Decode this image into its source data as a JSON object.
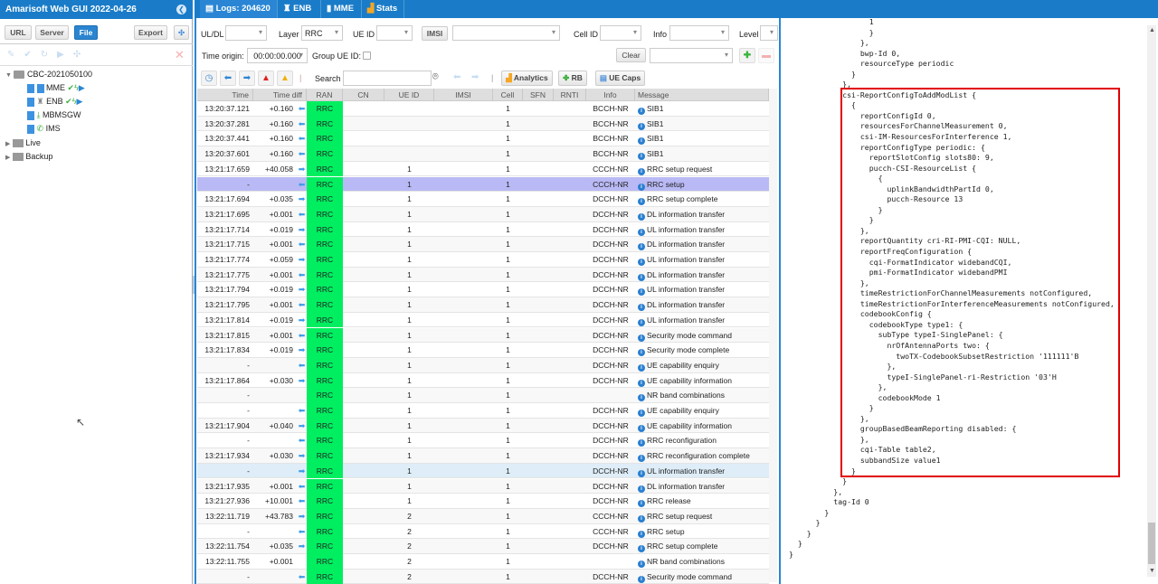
{
  "app": {
    "title": "Amarisoft Web GUI 2022-04-26"
  },
  "left": {
    "buttons": {
      "url": "URL",
      "server": "Server",
      "file": "File",
      "export": "Export"
    },
    "tree": {
      "root": "CBC-2021050100",
      "items": [
        "MME",
        "ENB",
        "MBMSGW",
        "IMS"
      ],
      "live": "Live",
      "backup": "Backup"
    }
  },
  "tabs": [
    {
      "label": "Logs: 204620",
      "icon": "document-icon"
    },
    {
      "label": "ENB",
      "icon": "antenna-icon"
    },
    {
      "label": "MME",
      "icon": "server-icon"
    },
    {
      "label": "Stats",
      "icon": "bar-chart-icon"
    }
  ],
  "filters": {
    "uldl_label": "UL/DL",
    "uldl_value": "",
    "layer_label": "Layer",
    "layer_value": "RRC",
    "ueid_label": "UE ID",
    "ueid_value": "",
    "imsi_label": "IMSI",
    "imsi_value": "",
    "cellid_label": "Cell ID",
    "cellid_value": "",
    "info_label": "Info",
    "info_value": "",
    "level_label": "Level",
    "level_value": "",
    "time_origin_label": "Time origin:",
    "time_origin_value": "00:00:00.000",
    "group_ueid_label": "Group UE ID:",
    "group_ueid_checked": false,
    "clear_label": "Clear"
  },
  "toolbar": {
    "search_label": "Search",
    "search_value": "",
    "analytics": "Analytics",
    "rb": "RB",
    "uecaps": "UE Caps"
  },
  "table": {
    "columns": [
      "Time",
      "Time diff",
      "RAN",
      "CN",
      "UE ID",
      "IMSI",
      "Cell",
      "SFN",
      "RNTI",
      "Info",
      "Message"
    ],
    "ran_color": "#00ee60",
    "rows": [
      {
        "time": "13:20:37.121",
        "diff": "+0.160",
        "dir": "dl",
        "ran": "RRC",
        "ue": "",
        "cell": "1",
        "info": "BCCH-NR",
        "msg": "SIB1"
      },
      {
        "time": "13:20:37.281",
        "diff": "+0.160",
        "dir": "dl",
        "ran": "RRC",
        "ue": "",
        "cell": "1",
        "info": "BCCH-NR",
        "msg": "SIB1"
      },
      {
        "time": "13:20:37.441",
        "diff": "+0.160",
        "dir": "dl",
        "ran": "RRC",
        "ue": "",
        "cell": "1",
        "info": "BCCH-NR",
        "msg": "SIB1"
      },
      {
        "time": "13:20:37.601",
        "diff": "+0.160",
        "dir": "dl",
        "ran": "RRC",
        "ue": "",
        "cell": "1",
        "info": "BCCH-NR",
        "msg": "SIB1"
      },
      {
        "time": "13:21:17.659",
        "diff": "+40.058",
        "dir": "ul",
        "ran": "RRC",
        "ue": "1",
        "cell": "1",
        "info": "CCCH-NR",
        "msg": "RRC setup request"
      },
      {
        "time": "-",
        "diff": "",
        "dir": "dl",
        "ran": "RRC",
        "ue": "1",
        "cell": "1",
        "info": "CCCH-NR",
        "msg": "RRC setup",
        "selected": true
      },
      {
        "time": "13:21:17.694",
        "diff": "+0.035",
        "dir": "ul",
        "ran": "RRC",
        "ue": "1",
        "cell": "1",
        "info": "DCCH-NR",
        "msg": "RRC setup complete"
      },
      {
        "time": "13:21:17.695",
        "diff": "+0.001",
        "dir": "dl",
        "ran": "RRC",
        "ue": "1",
        "cell": "1",
        "info": "DCCH-NR",
        "msg": "DL information transfer"
      },
      {
        "time": "13:21:17.714",
        "diff": "+0.019",
        "dir": "ul",
        "ran": "RRC",
        "ue": "1",
        "cell": "1",
        "info": "DCCH-NR",
        "msg": "UL information transfer"
      },
      {
        "time": "13:21:17.715",
        "diff": "+0.001",
        "dir": "dl",
        "ran": "RRC",
        "ue": "1",
        "cell": "1",
        "info": "DCCH-NR",
        "msg": "DL information transfer"
      },
      {
        "time": "13:21:17.774",
        "diff": "+0.059",
        "dir": "ul",
        "ran": "RRC",
        "ue": "1",
        "cell": "1",
        "info": "DCCH-NR",
        "msg": "UL information transfer"
      },
      {
        "time": "13:21:17.775",
        "diff": "+0.001",
        "dir": "dl",
        "ran": "RRC",
        "ue": "1",
        "cell": "1",
        "info": "DCCH-NR",
        "msg": "DL information transfer"
      },
      {
        "time": "13:21:17.794",
        "diff": "+0.019",
        "dir": "ul",
        "ran": "RRC",
        "ue": "1",
        "cell": "1",
        "info": "DCCH-NR",
        "msg": "UL information transfer"
      },
      {
        "time": "13:21:17.795",
        "diff": "+0.001",
        "dir": "dl",
        "ran": "RRC",
        "ue": "1",
        "cell": "1",
        "info": "DCCH-NR",
        "msg": "DL information transfer"
      },
      {
        "time": "13:21:17.814",
        "diff": "+0.019",
        "dir": "ul",
        "ran": "RRC",
        "ue": "1",
        "cell": "1",
        "info": "DCCH-NR",
        "msg": "UL information transfer"
      },
      {
        "time": "13:21:17.815",
        "diff": "+0.001",
        "dir": "dl",
        "ran": "RRC",
        "ue": "1",
        "cell": "1",
        "info": "DCCH-NR",
        "msg": "Security mode command"
      },
      {
        "time": "13:21:17.834",
        "diff": "+0.019",
        "dir": "ul",
        "ran": "RRC",
        "ue": "1",
        "cell": "1",
        "info": "DCCH-NR",
        "msg": "Security mode complete"
      },
      {
        "time": "-",
        "diff": "",
        "dir": "dl",
        "ran": "RRC",
        "ue": "1",
        "cell": "1",
        "info": "DCCH-NR",
        "msg": "UE capability enquiry"
      },
      {
        "time": "13:21:17.864",
        "diff": "+0.030",
        "dir": "ul",
        "ran": "RRC",
        "ue": "1",
        "cell": "1",
        "info": "DCCH-NR",
        "msg": "UE capability information"
      },
      {
        "time": "-",
        "diff": "",
        "dir": "",
        "ran": "RRC",
        "ue": "1",
        "cell": "1",
        "info": "",
        "msg": "NR band combinations"
      },
      {
        "time": "-",
        "diff": "",
        "dir": "dl",
        "ran": "RRC",
        "ue": "1",
        "cell": "1",
        "info": "DCCH-NR",
        "msg": "UE capability enquiry"
      },
      {
        "time": "13:21:17.904",
        "diff": "+0.040",
        "dir": "ul",
        "ran": "RRC",
        "ue": "1",
        "cell": "1",
        "info": "DCCH-NR",
        "msg": "UE capability information"
      },
      {
        "time": "-",
        "diff": "",
        "dir": "dl",
        "ran": "RRC",
        "ue": "1",
        "cell": "1",
        "info": "DCCH-NR",
        "msg": "RRC reconfiguration"
      },
      {
        "time": "13:21:17.934",
        "diff": "+0.030",
        "dir": "ul",
        "ran": "RRC",
        "ue": "1",
        "cell": "1",
        "info": "DCCH-NR",
        "msg": "RRC reconfiguration complete"
      },
      {
        "time": "-",
        "diff": "",
        "dir": "ul",
        "ran": "RRC",
        "ue": "1",
        "cell": "1",
        "info": "DCCH-NR",
        "msg": "UL information transfer",
        "hover": true
      },
      {
        "time": "13:21:17.935",
        "diff": "+0.001",
        "dir": "dl",
        "ran": "RRC",
        "ue": "1",
        "cell": "1",
        "info": "DCCH-NR",
        "msg": "DL information transfer"
      },
      {
        "time": "13:21:27.936",
        "diff": "+10.001",
        "dir": "dl",
        "ran": "RRC",
        "ue": "1",
        "cell": "1",
        "info": "DCCH-NR",
        "msg": "RRC release"
      },
      {
        "time": "13:22:11.719",
        "diff": "+43.783",
        "dir": "ul",
        "ran": "RRC",
        "ue": "2",
        "cell": "1",
        "info": "CCCH-NR",
        "msg": "RRC setup request"
      },
      {
        "time": "-",
        "diff": "",
        "dir": "dl",
        "ran": "RRC",
        "ue": "2",
        "cell": "1",
        "info": "CCCH-NR",
        "msg": "RRC setup"
      },
      {
        "time": "13:22:11.754",
        "diff": "+0.035",
        "dir": "ul",
        "ran": "RRC",
        "ue": "2",
        "cell": "1",
        "info": "DCCH-NR",
        "msg": "RRC setup complete"
      },
      {
        "time": "13:22:11.755",
        "diff": "+0.001",
        "dir": "",
        "ran": "RRC",
        "ue": "2",
        "cell": "1",
        "info": "",
        "msg": "NR band combinations"
      },
      {
        "time": "-",
        "diff": "",
        "dir": "dl",
        "ran": "RRC",
        "ue": "2",
        "cell": "1",
        "info": "DCCH-NR",
        "msg": "Security mode command"
      }
    ]
  },
  "detail": {
    "highlight_color": "#e00000",
    "code": "                  1\n                  }\n                },\n                bwp-Id 0,\n                resourceType periodic\n              }\n            },\n            csi-ReportConfigToAddModList {\n              {\n                reportConfigId 0,\n                resourcesForChannelMeasurement 0,\n                csi-IM-ResourcesForInterference 1,\n                reportConfigType periodic: {\n                  reportSlotConfig slots80: 9,\n                  pucch-CSI-ResourceList {\n                    {\n                      uplinkBandwidthPartId 0,\n                      pucch-Resource 13\n                    }\n                  }\n                },\n                reportQuantity cri-RI-PMI-CQI: NULL,\n                reportFreqConfiguration {\n                  cqi-FormatIndicator widebandCQI,\n                  pmi-FormatIndicator widebandPMI\n                },\n                timeRestrictionForChannelMeasurements notConfigured,\n                timeRestrictionForInterferenceMeasurements notConfigured,\n                codebookConfig {\n                  codebookType type1: {\n                    subType typeI-SinglePanel: {\n                      nrOfAntennaPorts two: {\n                        twoTX-CodebookSubsetRestriction '111111'B\n                      },\n                      typeI-SinglePanel-ri-Restriction '03'H\n                    },\n                    codebookMode 1\n                  }\n                },\n                groupBasedBeamReporting disabled: {\n                },\n                cqi-Table table2,\n                subbandSize value1\n              }\n            }\n          },\n          tag-Id 0\n        }\n      }\n    }\n  }\n}"
  }
}
